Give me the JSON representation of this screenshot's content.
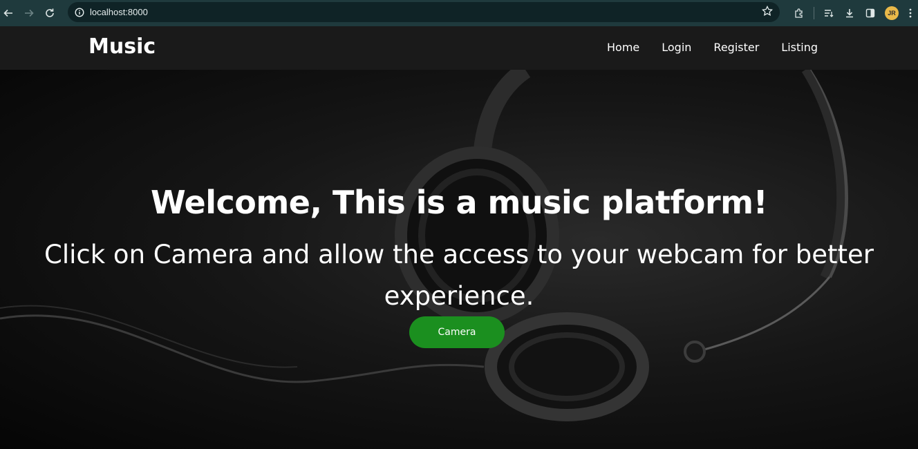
{
  "browser": {
    "url": "localhost:8000",
    "profile_initials": "JR",
    "icons": [
      "back-arrow-icon",
      "forward-arrow-icon",
      "reload-icon",
      "site-info-icon",
      "bookmark-star-icon",
      "extensions-icon",
      "reading-list-icon",
      "download-icon",
      "side-panel-icon",
      "profile-avatar",
      "more-menu-icon"
    ]
  },
  "navbar": {
    "brand": "Music",
    "links": [
      {
        "label": "Home"
      },
      {
        "label": "Login"
      },
      {
        "label": "Register"
      },
      {
        "label": "Listing"
      }
    ]
  },
  "hero": {
    "title": "Welcome, This is a music platform!",
    "subtitle": "Click on Camera and allow the access to your webcam for better experience.",
    "button_label": "Camera",
    "background_image": "headphones-photo"
  },
  "colors": {
    "chrome_bg": "#1f3a3d",
    "omnibox_bg": "#0f2326",
    "navbar_bg": "#1a1a1a",
    "button_green": "#1b8f1f",
    "text": "#ffffff"
  }
}
